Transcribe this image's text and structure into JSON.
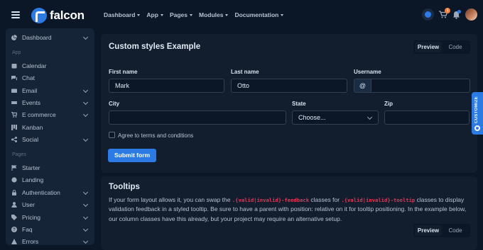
{
  "brand": {
    "name": "falcon"
  },
  "nav": [
    "Dashboard",
    "App",
    "Pages",
    "Modules",
    "Documentation"
  ],
  "header": {
    "cart_count": "1"
  },
  "sidebar": {
    "items_top": [
      {
        "label": "Dashboard",
        "icon": "pie-chart-icon",
        "chevron": true
      }
    ],
    "section_app": "App",
    "items_app": [
      {
        "label": "Calendar",
        "icon": "calendar-icon",
        "chevron": false
      },
      {
        "label": "Chat",
        "icon": "comments-icon",
        "chevron": false
      },
      {
        "label": "Email",
        "icon": "envelope-icon",
        "chevron": true
      },
      {
        "label": "Events",
        "icon": "ticket-icon",
        "chevron": true
      },
      {
        "label": "E commerce",
        "icon": "cart-icon",
        "chevron": true
      },
      {
        "label": "Kanban",
        "icon": "kanban-icon",
        "chevron": false
      },
      {
        "label": "Social",
        "icon": "share-icon",
        "chevron": true
      }
    ],
    "section_pages": "Pages",
    "items_pages": [
      {
        "label": "Starter",
        "icon": "flag-icon",
        "chevron": false
      },
      {
        "label": "Landing",
        "icon": "globe-icon",
        "chevron": false
      },
      {
        "label": "Authentication",
        "icon": "lock-icon",
        "chevron": true
      },
      {
        "label": "User",
        "icon": "user-icon",
        "chevron": true
      },
      {
        "label": "Pricing",
        "icon": "tags-icon",
        "chevron": true
      },
      {
        "label": "Faq",
        "icon": "question-icon",
        "chevron": true
      },
      {
        "label": "Errors",
        "icon": "warning-icon",
        "chevron": true
      }
    ]
  },
  "form_card": {
    "title": "Custom styles Example",
    "tab_preview": "Preview",
    "tab_code": "Code",
    "first_name_label": "First name",
    "first_name_value": "Mark",
    "last_name_label": "Last name",
    "last_name_value": "Otto",
    "username_label": "Username",
    "username_prefix": "@",
    "username_value": "",
    "city_label": "City",
    "city_value": "",
    "state_label": "State",
    "state_value": "Choose...",
    "zip_label": "Zip",
    "zip_value": "",
    "terms_label": "Agree to terms and conditions",
    "submit_label": "Submit form"
  },
  "tooltips_card": {
    "title": "Tooltips",
    "text_1": "If your form layout allows it, you can swap the ",
    "code_1": ".{valid|invalid}-feedback",
    "text_2": " classes for ",
    "code_2": ".{valid|invalid}-tooltip",
    "text_3": " classes to display validation feedback in a styled tooltip. Be sure to have a parent with position: relative on it for tooltip positioning. In the example below, our column classes have this already, but your project may require an alternative setup.",
    "tab_preview": "Preview",
    "tab_code": "Code"
  },
  "customize": {
    "label": "CUSTOMIZE"
  },
  "colors": {
    "primary": "#2c7be5",
    "background": "#0b1727",
    "card": "#121e2d",
    "sidebar": "#162438",
    "code": "#e63757"
  }
}
